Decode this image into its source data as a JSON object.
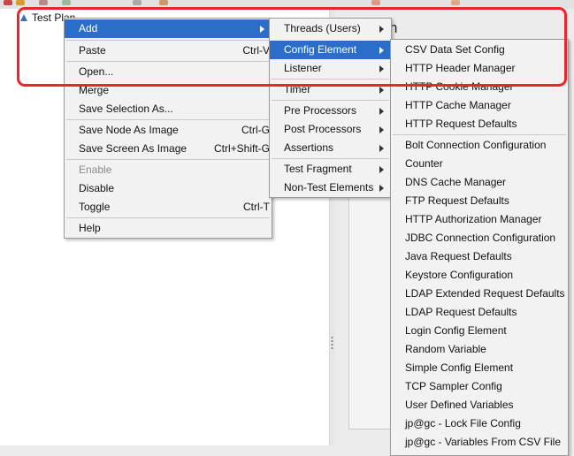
{
  "tree": {
    "root_label": "Test Plan"
  },
  "panel": {
    "title_fragment": "n"
  },
  "context_menu": {
    "items": [
      {
        "label": "Add",
        "accel": "",
        "submenu": true
      },
      {
        "label": "Paste",
        "accel": "Ctrl-V"
      },
      {
        "label": "Open...",
        "accel": ""
      },
      {
        "label": "Merge",
        "accel": ""
      },
      {
        "label": "Save Selection As...",
        "accel": ""
      },
      {
        "label": "Save Node As Image",
        "accel": "Ctrl-G"
      },
      {
        "label": "Save Screen As Image",
        "accel": "Ctrl+Shift-G"
      },
      {
        "label": "Enable",
        "accel": "",
        "disabled": true
      },
      {
        "label": "Disable",
        "accel": ""
      },
      {
        "label": "Toggle",
        "accel": "Ctrl-T"
      },
      {
        "label": "Help",
        "accel": ""
      }
    ]
  },
  "add_submenu": {
    "items": [
      {
        "label": "Threads (Users)"
      },
      {
        "label": "Config Element"
      },
      {
        "label": "Listener"
      },
      {
        "label": "Timer"
      },
      {
        "label": "Pre Processors"
      },
      {
        "label": "Post Processors"
      },
      {
        "label": "Assertions"
      },
      {
        "label": "Test Fragment"
      },
      {
        "label": "Non-Test Elements"
      }
    ]
  },
  "config_submenu": {
    "items": [
      {
        "label": "CSV Data Set Config"
      },
      {
        "label": "HTTP Header Manager"
      },
      {
        "label": "HTTP Cookie Manager"
      },
      {
        "label": "HTTP Cache Manager"
      },
      {
        "label": "HTTP Request Defaults"
      },
      {
        "label": "Bolt Connection Configuration"
      },
      {
        "label": "Counter"
      },
      {
        "label": "DNS Cache Manager"
      },
      {
        "label": "FTP Request Defaults"
      },
      {
        "label": "HTTP Authorization Manager"
      },
      {
        "label": "JDBC Connection Configuration"
      },
      {
        "label": "Java Request Defaults"
      },
      {
        "label": "Keystore Configuration"
      },
      {
        "label": "LDAP Extended Request Defaults"
      },
      {
        "label": "LDAP Request Defaults"
      },
      {
        "label": "Login Config Element"
      },
      {
        "label": "Random Variable"
      },
      {
        "label": "Simple Config Element"
      },
      {
        "label": "TCP Sampler Config"
      },
      {
        "label": "User Defined Variables"
      },
      {
        "label": "jp@gc - Lock File Config"
      },
      {
        "label": "jp@gc - Variables From CSV File"
      }
    ]
  },
  "colors": {
    "selection": "#2a6ec9",
    "annotation": "#e8262b",
    "menu_bg": "#f2f2f2"
  }
}
